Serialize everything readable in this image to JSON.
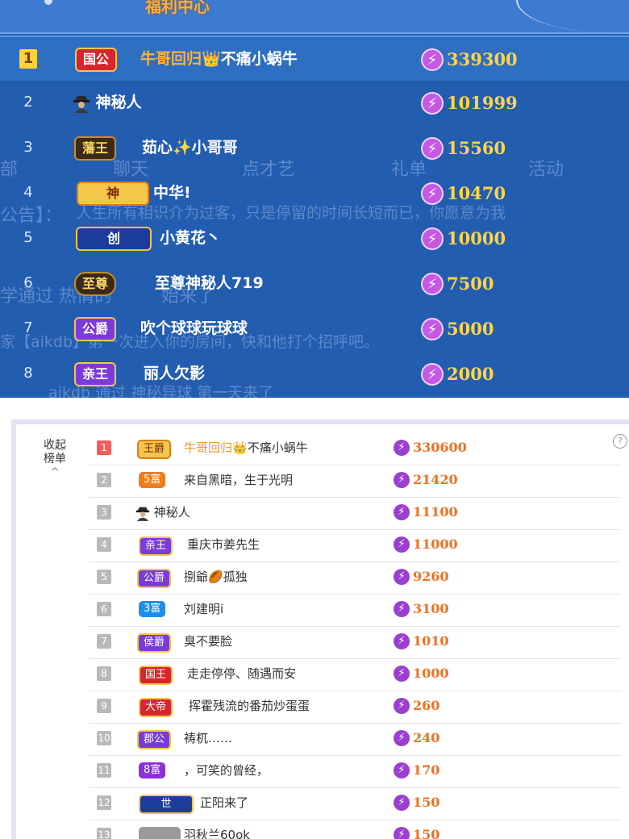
{
  "top_panel": {
    "header_text": "福利中心",
    "background_fragments": [
      "部",
      "聊天",
      "点才艺",
      "礼单",
      "活动",
      "公告】：",
      "人生所有相识介为过客，只是停留的时间长短而已，你愿意为我",
      "学通过 热情的",
      "始来了",
      "家【aikdb】第一次进入你的房间，快和他打个招呼吧。",
      "aikdb 通过 神秘异球 第一天来了"
    ],
    "rows": [
      {
        "rank": "1",
        "badge": "国公",
        "name_prefix": "牛哥回归",
        "name_suffix": "不痛小蜗牛",
        "score": "339300"
      },
      {
        "rank": "2",
        "badge": "",
        "name": "神秘人",
        "score": "101999"
      },
      {
        "rank": "3",
        "badge": "藩王",
        "name": "茹心✨小哥哥",
        "score": "15560"
      },
      {
        "rank": "4",
        "badge": "神",
        "name": "中华!",
        "score": "10470"
      },
      {
        "rank": "5",
        "badge": "创",
        "name": "小黄花丶",
        "score": "10000"
      },
      {
        "rank": "6",
        "badge": "至尊",
        "name": "至尊神秘人719",
        "score": "7500"
      },
      {
        "rank": "7",
        "badge": "公爵",
        "name": "吹个球球玩球球",
        "score": "5000"
      },
      {
        "rank": "8",
        "badge": "亲王",
        "name": "丽人欠影",
        "score": "2000"
      }
    ]
  },
  "bottom_panel": {
    "collapse_label": "收起榜单",
    "collapse_arrow": "^",
    "help_icon": "?",
    "rows": [
      {
        "rank": "1",
        "badge": "王爵",
        "name_prefix": "牛哥回归",
        "name_suffix": "不痛小蜗牛",
        "score": "330600"
      },
      {
        "rank": "2",
        "badge": "5富",
        "name": "来自黑暗，生于光明",
        "score": "21420"
      },
      {
        "rank": "3",
        "badge": "",
        "name": "神秘人",
        "score": "11100"
      },
      {
        "rank": "4",
        "badge": "亲王",
        "name": "重庆市姜先生",
        "score": "11000"
      },
      {
        "rank": "5",
        "badge": "公爵",
        "name": "捌爺🏉孤独",
        "score": "9260"
      },
      {
        "rank": "6",
        "badge": "3富",
        "name": "刘建明i",
        "score": "3100"
      },
      {
        "rank": "7",
        "badge": "侯爵",
        "name": "臭不要脸",
        "score": "1010"
      },
      {
        "rank": "8",
        "badge": "国王",
        "name": "走走停停、随遇而安",
        "score": "1000"
      },
      {
        "rank": "9",
        "badge": "大帝",
        "name": "挥霍残流的番茄炒蛋蛋",
        "score": "260"
      },
      {
        "rank": "10",
        "badge": "郡公",
        "name": "祷杌……",
        "score": "240"
      },
      {
        "rank": "11",
        "badge": "8富",
        "name": "，可笑的曾经，",
        "score": "170"
      },
      {
        "rank": "12",
        "badge": "世",
        "name": "正阳来了",
        "score": "150"
      },
      {
        "rank": "13",
        "badge": "",
        "name": "羽秋兰60ok",
        "score": "150"
      }
    ]
  },
  "colors": {
    "top_bg": "#2a64b4",
    "top_score": "#ffd54a",
    "bottom_score": "#f26f1e",
    "rank1_bottom": "#f25d5d"
  }
}
